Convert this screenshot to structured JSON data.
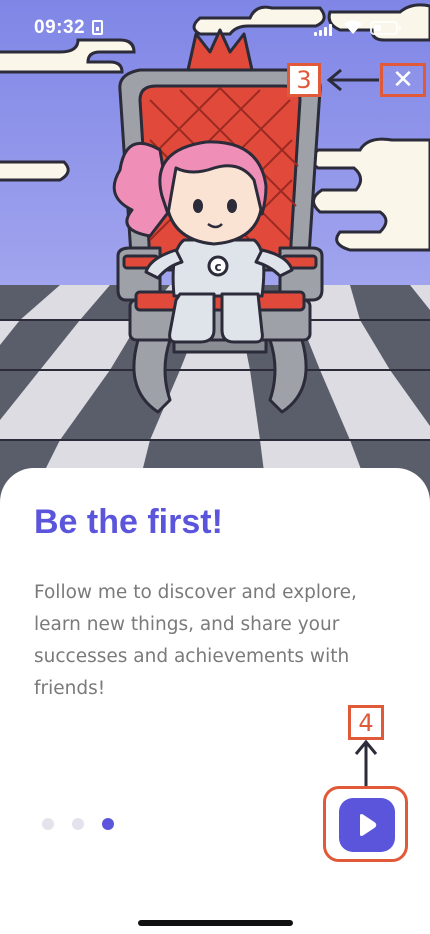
{
  "status_bar": {
    "time": "09:32",
    "icons": [
      "sim-card-icon",
      "signal-icon",
      "wifi-icon",
      "battery-icon"
    ]
  },
  "illustration": {
    "subject": "character-on-throne",
    "colors": {
      "sky": "#8b8fe8",
      "throne": "#9a9a9a",
      "cushion": "#e14a3a",
      "hair": "#ef8fb8",
      "floor_dark": "#5b5f6b",
      "floor_light": "#dedee2"
    }
  },
  "annotations": {
    "close_marker": "3",
    "next_marker": "4"
  },
  "card": {
    "title": "Be the first!",
    "body": "Follow me to discover and explore, learn new things, and share your successes and achievements with friends!"
  },
  "pager": {
    "pages": 3,
    "active": 3
  },
  "buttons": {
    "close_icon": "close-icon",
    "next_icon": "play-icon"
  },
  "colors": {
    "accent": "#5b55dc",
    "annotation": "#e05a3a",
    "body_text": "#7a7a7a"
  }
}
